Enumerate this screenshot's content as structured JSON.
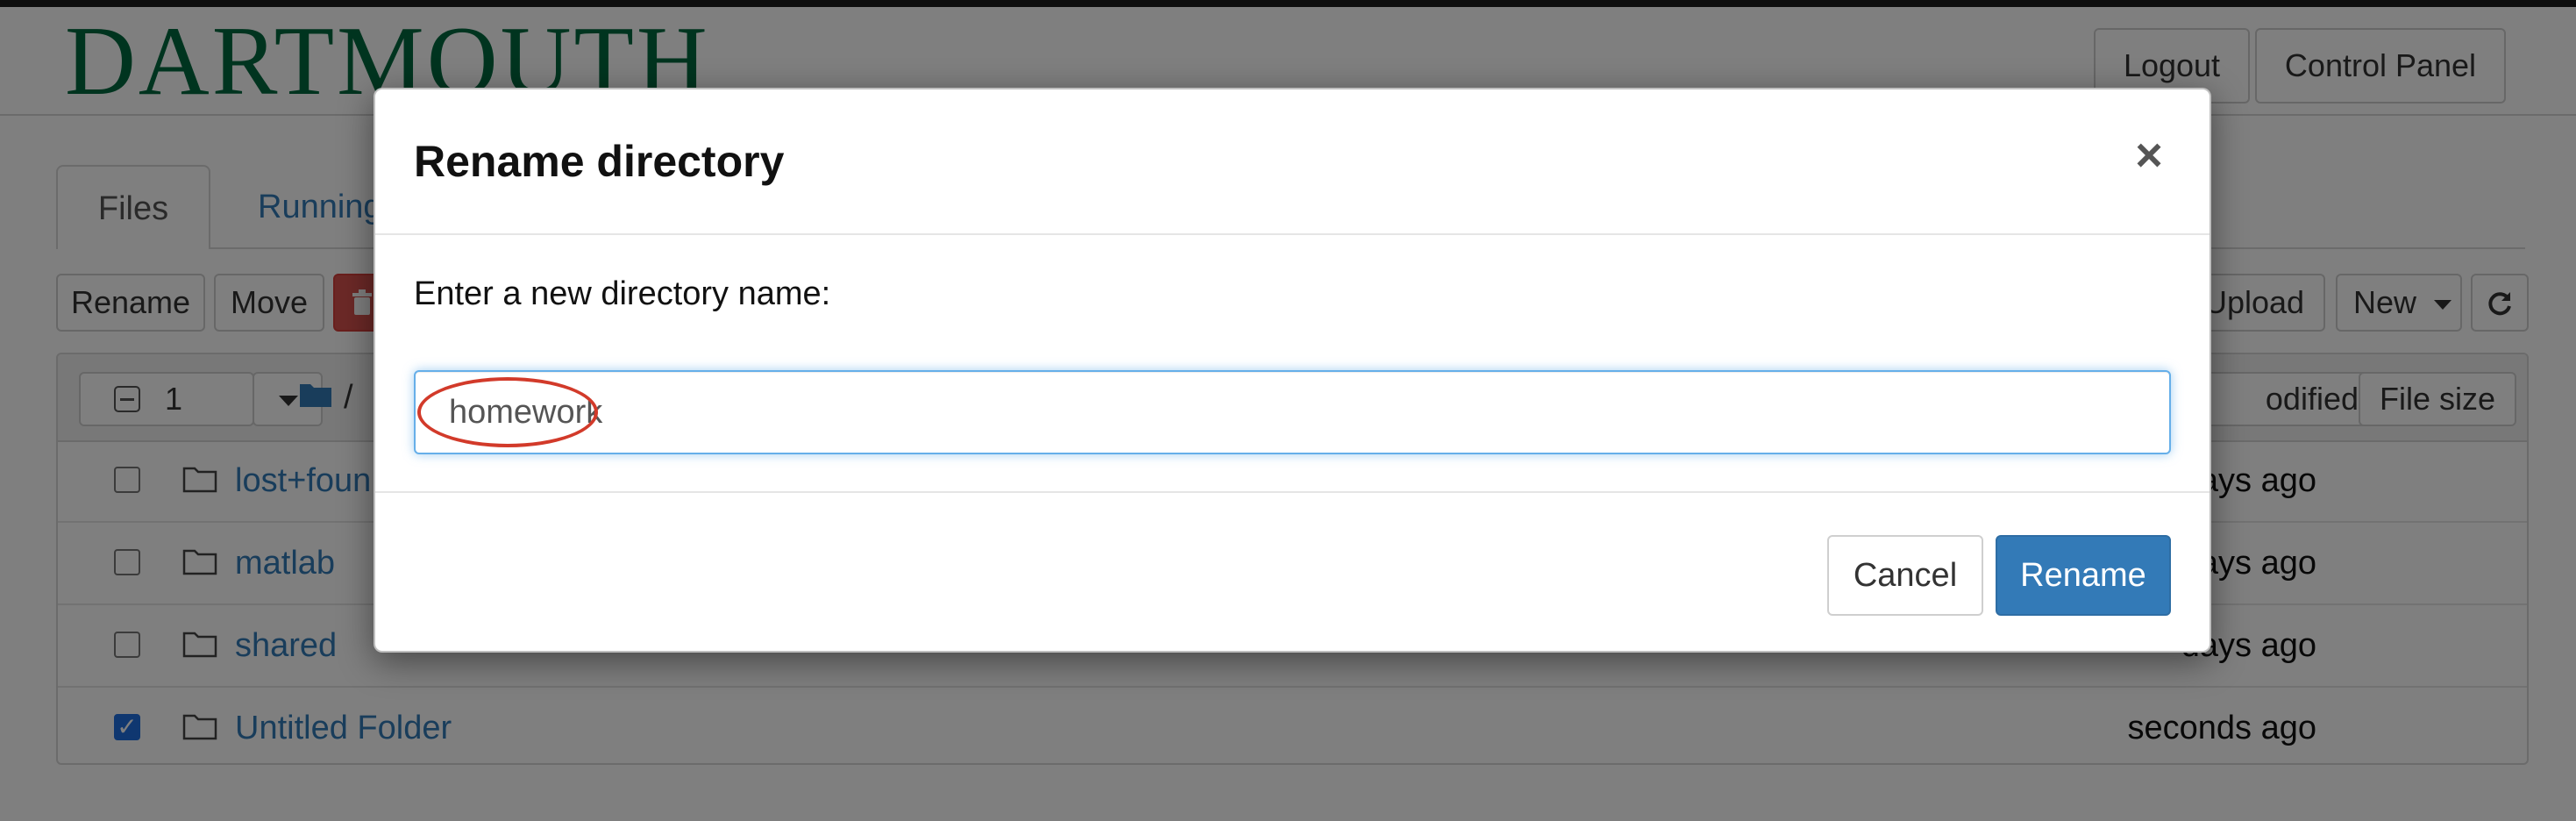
{
  "header": {
    "logo_text": "DARTMOUTH",
    "logout_label": "Logout",
    "control_panel_label": "Control Panel"
  },
  "tabs": {
    "files_label": "Files",
    "running_label": "Running"
  },
  "toolbar": {
    "rename_label": "Rename",
    "move_label": "Move",
    "upload_label": "Upload",
    "new_label": "New",
    "refresh_icon": "refresh-icon",
    "delete_icon": "trash-icon"
  },
  "list_header": {
    "selected_count": "1",
    "path": "/",
    "last_modified_label": "odified",
    "file_size_label": "File size"
  },
  "files": [
    {
      "name": "lost+foun",
      "modified": "ays ago",
      "checked": false
    },
    {
      "name": "matlab",
      "modified": "ays ago",
      "checked": false
    },
    {
      "name": "shared",
      "modified": "days ago",
      "checked": false
    },
    {
      "name": "Untitled Folder",
      "modified": "seconds ago",
      "checked": true
    }
  ],
  "dialog": {
    "title": "Rename directory",
    "prompt": "Enter a new directory name:",
    "input_value": "homework",
    "cancel_label": "Cancel",
    "confirm_label": "Rename",
    "close_glyph": "×"
  },
  "colors": {
    "brand_green": "#00693e",
    "link_blue": "#337ab7",
    "primary_button": "#337ab7",
    "delete_red": "#d9534f",
    "annotation_red": "#d23a2a"
  }
}
